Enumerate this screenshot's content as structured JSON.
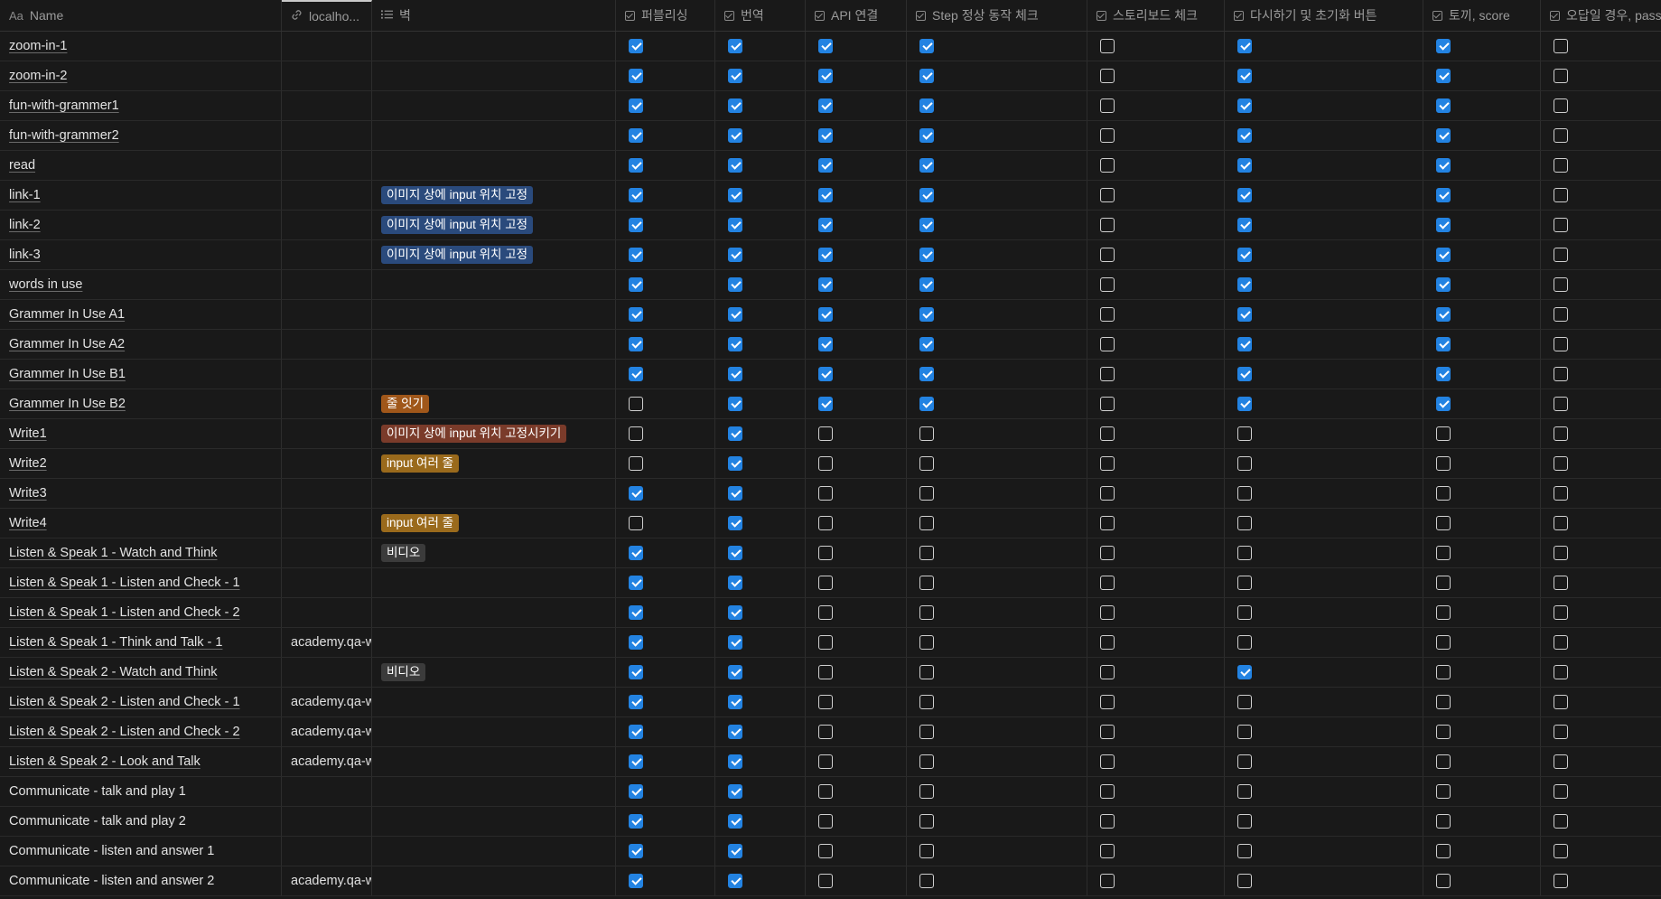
{
  "headers": {
    "name": "Name",
    "name_icon": "Aa",
    "url": "localho...",
    "tag": "벽",
    "cb": [
      "퍼블리싱",
      "번역",
      "API 연결",
      "Step 정상 동작 체크",
      "스토리보드 체크",
      "다시하기 및 초기화 버튼",
      "토끼, score",
      "오답일 경우, pass"
    ]
  },
  "colors": {
    "checkbox": "#2383e2",
    "background": "#191919"
  },
  "rows": [
    {
      "name": "zoom-in-1",
      "url": "",
      "tag": "",
      "tagColor": "",
      "checks": [
        1,
        1,
        1,
        1,
        0,
        1,
        1,
        0
      ]
    },
    {
      "name": "zoom-in-2",
      "url": "",
      "tag": "",
      "tagColor": "",
      "checks": [
        1,
        1,
        1,
        1,
        0,
        1,
        1,
        0
      ]
    },
    {
      "name": "fun-with-grammer1",
      "url": "",
      "tag": "",
      "tagColor": "",
      "checks": [
        1,
        1,
        1,
        1,
        0,
        1,
        1,
        0
      ]
    },
    {
      "name": "fun-with-grammer2",
      "url": "",
      "tag": "",
      "tagColor": "",
      "checks": [
        1,
        1,
        1,
        1,
        0,
        1,
        1,
        0
      ]
    },
    {
      "name": "read",
      "url": "",
      "tag": "",
      "tagColor": "",
      "checks": [
        1,
        1,
        1,
        1,
        0,
        1,
        1,
        0
      ]
    },
    {
      "name": "link-1",
      "url": "",
      "tag": "이미지 상에 input 위치 고정",
      "tagColor": "blue",
      "checks": [
        1,
        1,
        1,
        1,
        0,
        1,
        1,
        0
      ]
    },
    {
      "name": "link-2",
      "url": "",
      "tag": "이미지 상에 input 위치 고정",
      "tagColor": "blue",
      "checks": [
        1,
        1,
        1,
        1,
        0,
        1,
        1,
        0
      ]
    },
    {
      "name": "link-3",
      "url": "",
      "tag": "이미지 상에 input 위치 고정",
      "tagColor": "blue",
      "checks": [
        1,
        1,
        1,
        1,
        0,
        1,
        1,
        0
      ]
    },
    {
      "name": "words in use",
      "url": "",
      "tag": "",
      "tagColor": "",
      "checks": [
        1,
        1,
        1,
        1,
        0,
        1,
        1,
        0
      ]
    },
    {
      "name": "Grammer In Use A1",
      "url": "",
      "tag": "",
      "tagColor": "",
      "checks": [
        1,
        1,
        1,
        1,
        0,
        1,
        1,
        0
      ]
    },
    {
      "name": "Grammer In Use A2",
      "url": "",
      "tag": "",
      "tagColor": "",
      "checks": [
        1,
        1,
        1,
        1,
        0,
        1,
        1,
        0
      ]
    },
    {
      "name": "Grammer In Use B1",
      "url": "",
      "tag": "",
      "tagColor": "",
      "checks": [
        1,
        1,
        1,
        1,
        0,
        1,
        1,
        0
      ]
    },
    {
      "name": "Grammer In Use B2",
      "url": "",
      "tag": "줄 잇기",
      "tagColor": "orange",
      "checks": [
        0,
        1,
        1,
        1,
        0,
        1,
        1,
        0
      ]
    },
    {
      "name": "Write1",
      "url": "",
      "tag": "이미지 상에 input 위치 고정시키기",
      "tagColor": "red",
      "checks": [
        0,
        1,
        0,
        0,
        0,
        0,
        0,
        0
      ]
    },
    {
      "name": "Write2",
      "url": "",
      "tag": "input 여러 줄",
      "tagColor": "amber",
      "checks": [
        0,
        1,
        0,
        0,
        0,
        0,
        0,
        0
      ]
    },
    {
      "name": "Write3",
      "url": "",
      "tag": "",
      "tagColor": "",
      "checks": [
        1,
        1,
        0,
        0,
        0,
        0,
        0,
        0
      ]
    },
    {
      "name": "Write4",
      "url": "",
      "tag": "input 여러 줄",
      "tagColor": "amber",
      "checks": [
        0,
        1,
        0,
        0,
        0,
        0,
        0,
        0
      ]
    },
    {
      "name": "Listen & Speak 1 - Watch and Think",
      "url": "",
      "tag": "비디오",
      "tagColor": "gray",
      "checks": [
        1,
        1,
        0,
        0,
        0,
        0,
        0,
        0
      ]
    },
    {
      "name": "Listen & Speak 1 - Listen and Check - 1",
      "url": "",
      "tag": "",
      "tagColor": "",
      "checks": [
        1,
        1,
        0,
        0,
        0,
        0,
        0,
        0
      ]
    },
    {
      "name": "Listen & Speak 1 - Listen and Check - 2",
      "url": "",
      "tag": "",
      "tagColor": "",
      "checks": [
        1,
        1,
        0,
        0,
        0,
        0,
        0,
        0
      ]
    },
    {
      "name": "Listen & Speak 1 - Think and Talk - 1",
      "url": "academy.qa-w",
      "tag": "",
      "tagColor": "",
      "checks": [
        1,
        1,
        0,
        0,
        0,
        0,
        0,
        0
      ]
    },
    {
      "name": "Listen & Speak 2 - Watch and Think",
      "url": "",
      "tag": "비디오",
      "tagColor": "gray",
      "checks": [
        1,
        1,
        0,
        0,
        0,
        1,
        0,
        0
      ]
    },
    {
      "name": "Listen & Speak 2 - Listen and Check - 1",
      "url": "academy.qa-w",
      "tag": "",
      "tagColor": "",
      "checks": [
        1,
        1,
        0,
        0,
        0,
        0,
        0,
        0
      ]
    },
    {
      "name": "Listen & Speak 2 - Listen and Check - 2",
      "url": "academy.qa-w",
      "tag": "",
      "tagColor": "",
      "checks": [
        1,
        1,
        0,
        0,
        0,
        0,
        0,
        0
      ]
    },
    {
      "name": "Listen & Speak 2 - Look and Talk",
      "url": "academy.qa-w",
      "tag": "",
      "tagColor": "",
      "checks": [
        1,
        1,
        0,
        0,
        0,
        0,
        0,
        0
      ]
    },
    {
      "name": "Communicate - talk and play 1",
      "url": "",
      "tag": "",
      "tagColor": "",
      "plain": true,
      "checks": [
        1,
        1,
        0,
        0,
        0,
        0,
        0,
        0
      ]
    },
    {
      "name": "Communicate - talk and play 2",
      "url": "",
      "tag": "",
      "tagColor": "",
      "plain": true,
      "checks": [
        1,
        1,
        0,
        0,
        0,
        0,
        0,
        0
      ]
    },
    {
      "name": "Communicate - listen and answer 1",
      "url": "",
      "tag": "",
      "tagColor": "",
      "plain": true,
      "checks": [
        1,
        1,
        0,
        0,
        0,
        0,
        0,
        0
      ]
    },
    {
      "name": "Communicate - listen and answer  2",
      "url": "academy.qa-w",
      "tag": "",
      "tagColor": "",
      "plain": true,
      "checks": [
        1,
        1,
        0,
        0,
        0,
        0,
        0,
        0
      ]
    }
  ]
}
